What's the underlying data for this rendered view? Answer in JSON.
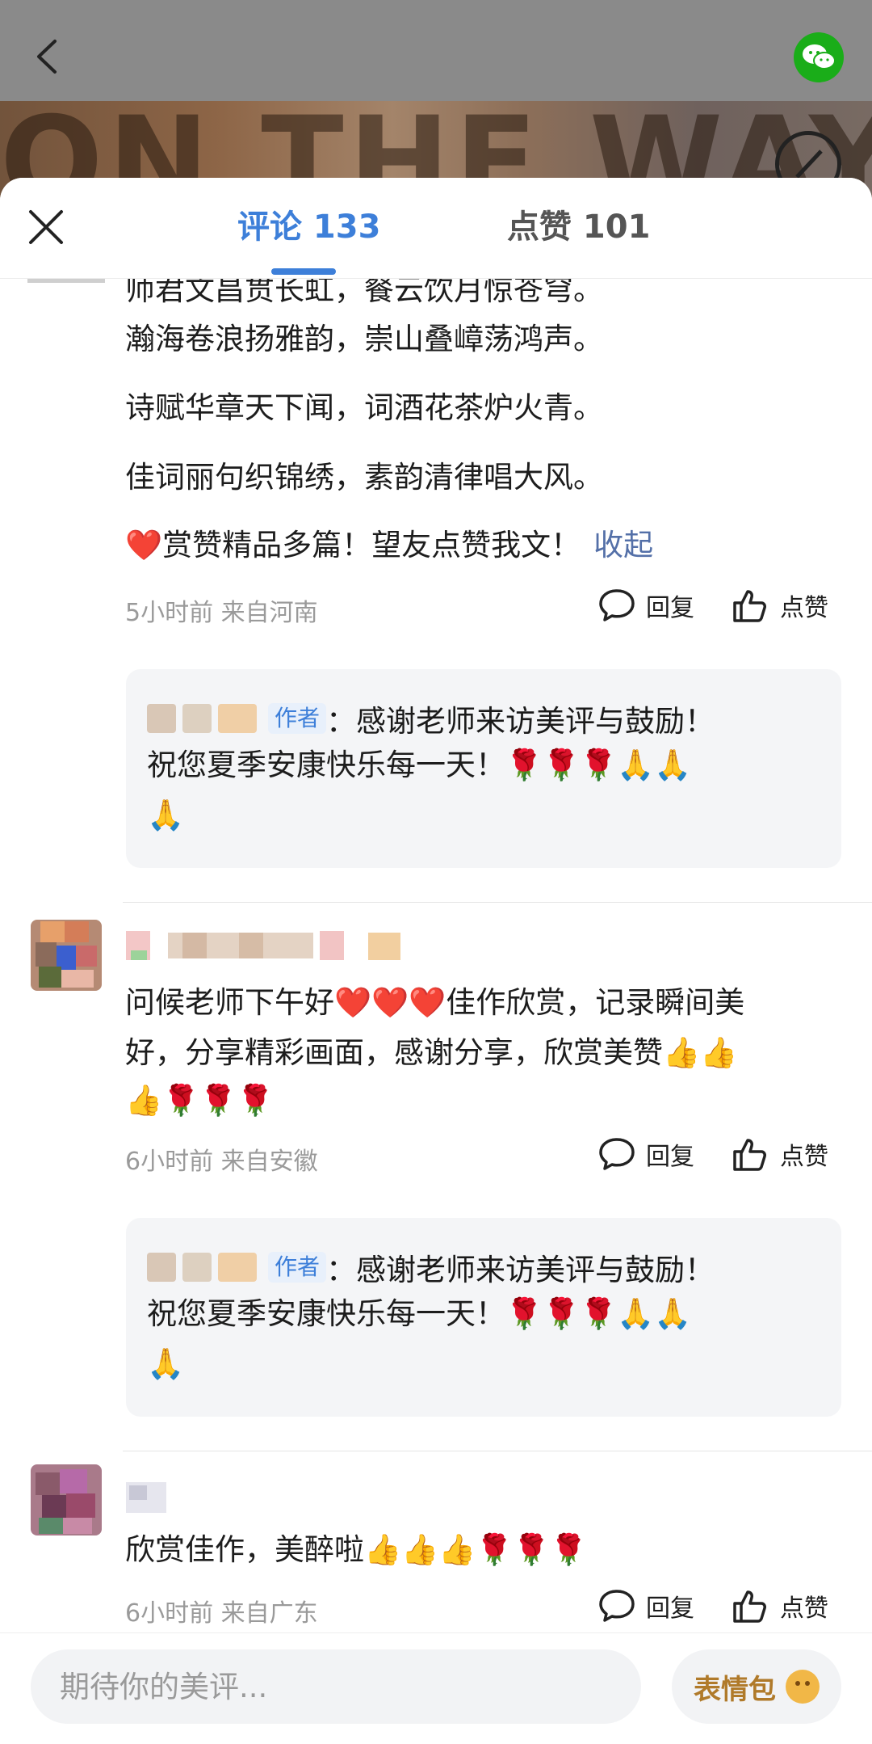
{
  "backdrop": {
    "title_text": "ON THE WAY"
  },
  "tabs": [
    {
      "label": "评论 133",
      "active": true
    },
    {
      "label": "点赞 101",
      "active": false
    }
  ],
  "comments": [
    {
      "lines": [
        "师君文昌贯长虹，餐云饮月惊苍穹。",
        "瀚海卷浪扬雅韵，崇山叠嶂荡鸿声。",
        "诗赋华章天下闻，词酒花茶炉火青。",
        "佳词丽句织锦绣，素韵清律唱大风。",
        "❤️赏赞精品多篇！望友点赞我文！"
      ],
      "fold_label": "收起",
      "meta": "5小时前  来自河南",
      "reply": {
        "author_tag": "作者",
        "colon": "：",
        "lines": [
          "感谢老师来访美评与鼓励！",
          "祝您夏季安康快乐每一天！🌹🌹🌹🙏🙏",
          "🙏"
        ]
      }
    },
    {
      "lines": [
        "问候老师下午好❤️❤️❤️佳作欣赏，记录瞬间美",
        "好，分享精彩画面，感谢分享，欣赏美赞👍👍",
        "👍🌹🌹🌹"
      ],
      "meta": "6小时前  来自安徽",
      "reply": {
        "author_tag": "作者",
        "colon": "：",
        "lines": [
          "感谢老师来访美评与鼓励！",
          "祝您夏季安康快乐每一天！🌹🌹🌹🙏🙏",
          "🙏"
        ]
      }
    },
    {
      "lines": [
        "欣赏佳作，美醉啦👍👍👍🌹🌹🌹"
      ],
      "meta": "6小时前  来自广东"
    }
  ],
  "actions": {
    "reply_label": "回复",
    "like_label": "点赞"
  },
  "bottom": {
    "input_placeholder": "期待你的美评...",
    "emoji_button_label": "表情包"
  },
  "colors": {
    "accent": "#3d7fd9",
    "wechat": "#1aad19",
    "fold_link": "#5470a8"
  },
  "icons": [
    "back-icon",
    "wechat-icon",
    "music-icon",
    "close-icon",
    "comment-bubble-icon",
    "thumbs-up-icon",
    "smile-face-icon"
  ]
}
